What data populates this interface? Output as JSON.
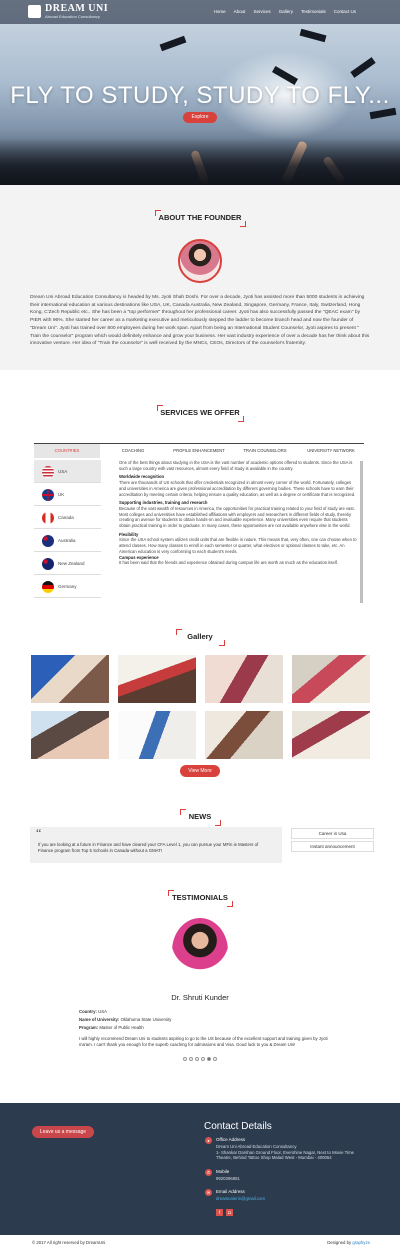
{
  "nav": {
    "logo_title": "DREAM UNI",
    "logo_subtitle": "Abroad Education Consultancy",
    "links": [
      "Home",
      "About",
      "Services",
      "Gallery",
      "Testimonials",
      "Contact Us"
    ]
  },
  "hero": {
    "title": "FLY TO STUDY, STUDY TO FLY...",
    "explore_label": "Explore"
  },
  "founder": {
    "heading": "ABOUT THE FOUNDER",
    "text": "Dream Uni Abroad Education Consultancy is headed by Ms. Jyoti Shah Doshi. For over a decade, Jyoti has assisted more than 5000 students in achieving their international education at various destinations like USA, UK, Canada Australia, New Zealand, Singapore, Germany, France, Italy, Switzerland, Hong Kong, C'Zech Republic etc.. She has been a \"top performer\" throughout her professional career. Jyoti has also successfully passed the \"QEAC exam\" by PIER with 96%. She started her career as a marketing executive and meticulously stepped the ladder to become branch head and now the founder of \"Dream Uni\". Jyoti has trained over 800 employees during her work span. Apart from being an International Student Counselor, Jyoti aspires to present \" Train the counselor\" program which would definitely enhance and grow your business. Her vast industry experience of over a decade has her think about this innovative venture. Her idea of \"Train the counselor\" is well received by the MNCs, CEOs, Directors of the counselor's fraternity."
  },
  "services": {
    "heading": "SERVICES WE OFFER",
    "tabs": [
      "COUNTRIES",
      "COACHING",
      "PROFILE ENHANCEMENT",
      "TRAIN COUNSELORS",
      "UNIVERSITY NETWORK"
    ],
    "countries": [
      "USA",
      "UK",
      "Canada",
      "Australia",
      "New Zealand",
      "Germany"
    ],
    "intro": "One of the best things about studying in the USA is the vast number of academic options offered to students. Since the USA is such a large country with vast resources, almost every field of study is available in the country.",
    "sections": [
      {
        "title": "Worldwide recognition",
        "text": "There are thousands of US schools that offer credentials recognized in almost every corner of the world. Fortunately, colleges and universities in America are given professional accreditation by different governing bodies. These schools have to earn their accreditation by meeting certain criteria, helping ensure a quality education, as well as a degree or certificate that is recognized."
      },
      {
        "title": "Supporting industries, training and research",
        "text": "Because of the vast wealth of resources in America, the opportunities for practical training related to your field of study are vast. Most colleges and universities have established affiliations with employers and researchers in different fields of study, thereby creating an avenue for students to obtain hands-on and invaluable experience. Many universities even require that students obtain practical training in order to graduate. In many cases, these opportunities are not available anywhere else in the world."
      },
      {
        "title": "Flexibility",
        "text": "Since the USA school system utilizes credit units that are flexible in nature. This means that, very often, one can choose when to attend classes. How many classes to enroll in each semester or quarter, what electives or optional classes to take, etc. An American education is very conforming to each student's needs."
      },
      {
        "title": "Campus experience",
        "text": "It has been said that the friends and experience obtained during campus life are worth as much as the education itself."
      }
    ]
  },
  "gallery": {
    "heading": "Gallery",
    "view_more_label": "View More"
  },
  "news": {
    "heading": "NEWS",
    "quote_mark": "“",
    "item": "If you are looking at a future in Finance and have cleared your CFA Level 1, you can pursue your MFin ie Masters of Finance program from Top 5 Schools in Canada without a GMAT!",
    "side_links": [
      "Career in Usa",
      "Instant announcement"
    ]
  },
  "testimonials": {
    "heading": "TESTIMONIALS",
    "name": "Dr. Shruti Kunder",
    "country_label": "Country:",
    "country": "USA",
    "university_label": "Name of University:",
    "university": "Oklahoma State University",
    "program_label": "Program:",
    "program": "Master of Public Health",
    "quote": "I will highly recommend Dream Uni to students aspiring to go to the US because of the excellent support and training given by Jyoti ma'am. I can't thank you enough for the superb coaching for admissions and Visa. Good luck to you & Dream Uni!"
  },
  "footer": {
    "leave_message_label": "Leave us a message",
    "contact_title": "Contact Details",
    "office_label": "Office Address",
    "office_lines": [
      "Dream Uni Abroad Education Consultancy",
      "1- Shankar Darshan Ground Floor, Evershine Nagar, Next to Movie Time",
      "Theatre, Behind Tattoo Shop Malad West - Mumbai - 400064"
    ],
    "mobile_label": "Mobile",
    "mobile": "9920396881",
    "email_label": "Email Address",
    "email": "dreamunierin@gmail.com",
    "copyright": "© 2017 All right reserved by DreamUni",
    "designed_by_label": "Designed by",
    "designed_by": "graphyze"
  },
  "colors": {
    "accent": "#d9413c",
    "footer_bg": "#2c3b4e",
    "founder_bg": "#f3f3f3"
  }
}
